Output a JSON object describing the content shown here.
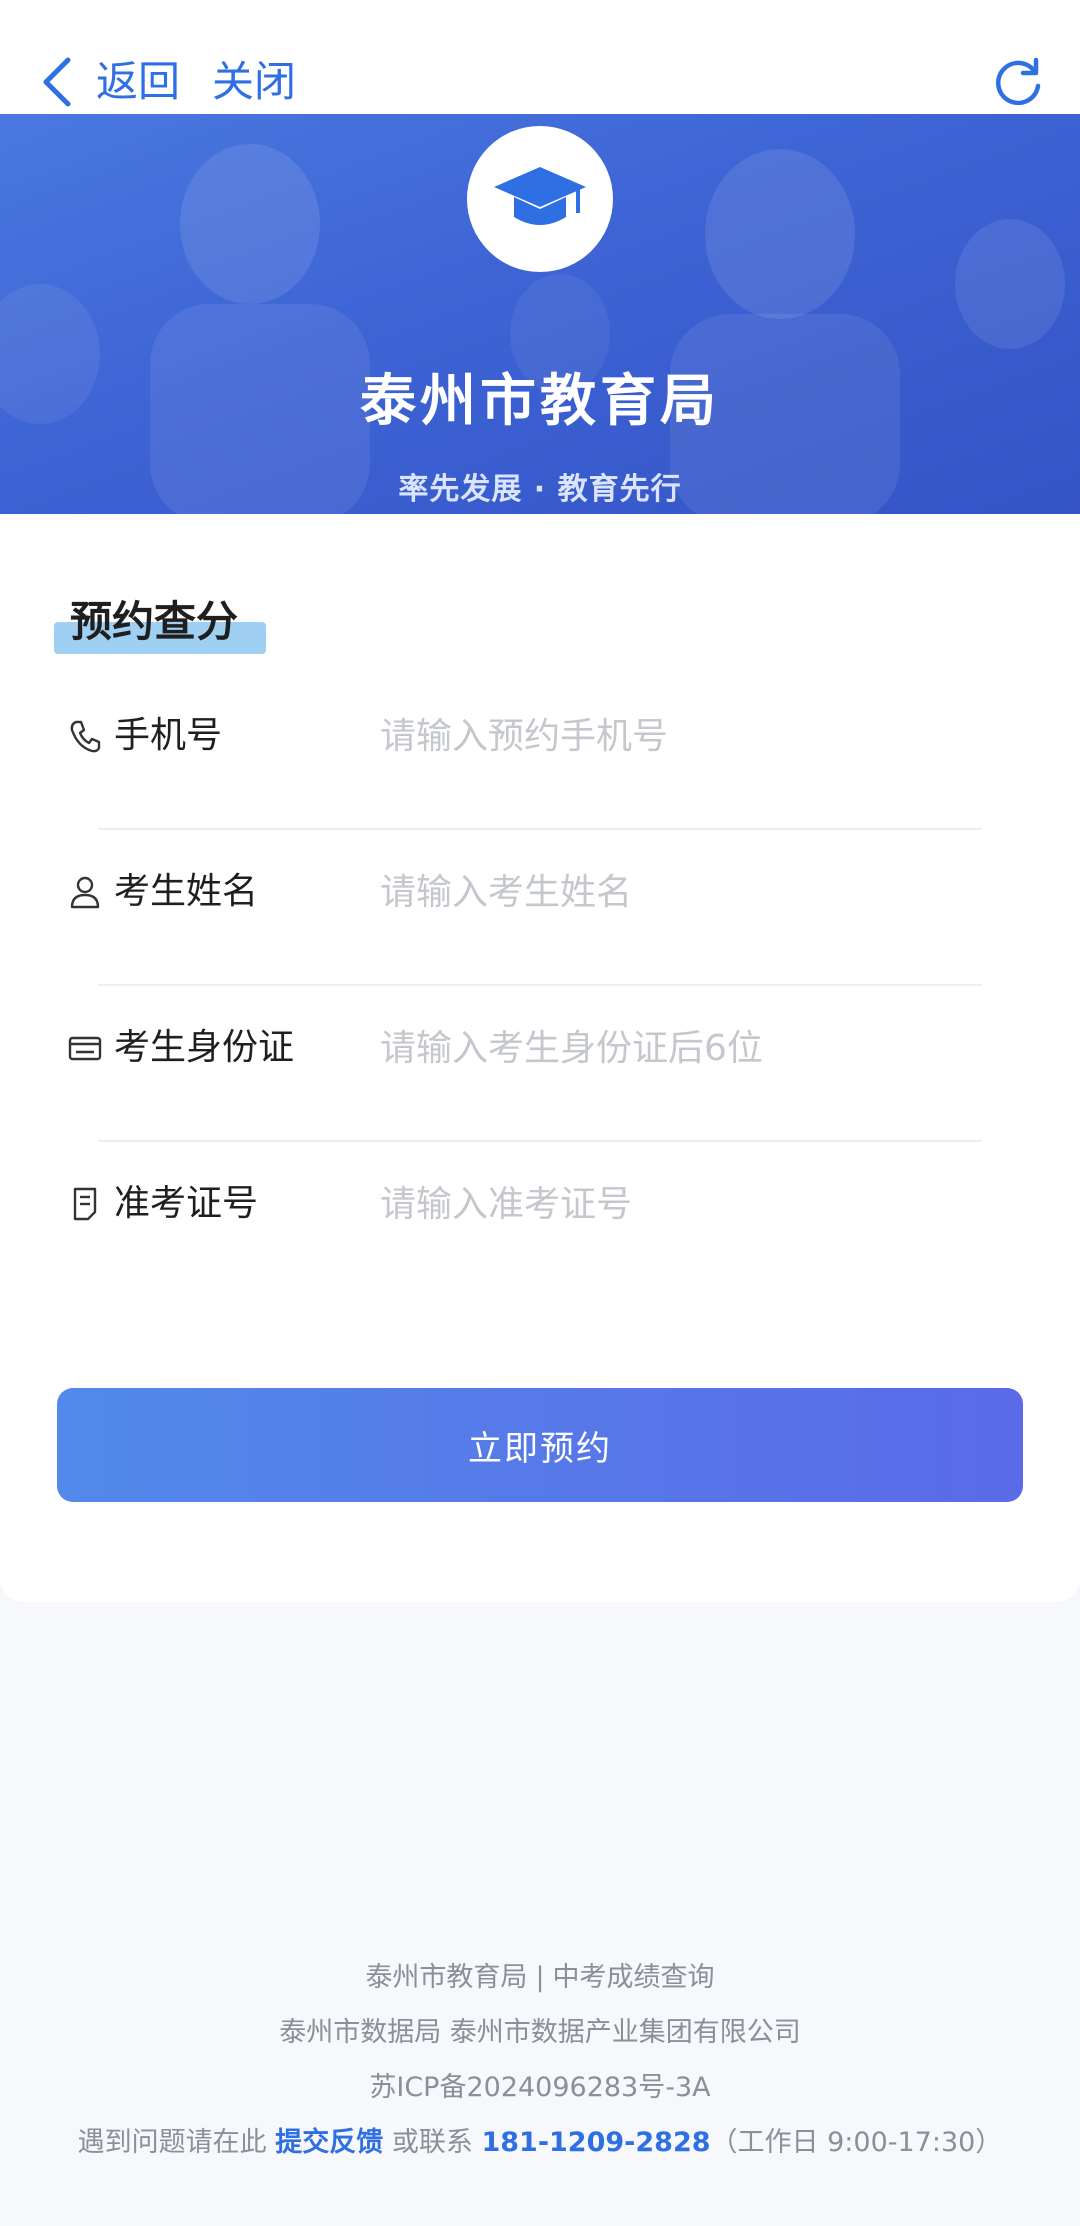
{
  "nav": {
    "back_label": "返回",
    "close_label": "关闭",
    "accent_color": "#2f6fe4"
  },
  "banner": {
    "title": "泰州市教育局",
    "subtitle": "率先发展 · 教育先行",
    "logo_icon": "graduation-cap-icon"
  },
  "form": {
    "section_title": "预约查分",
    "fields": [
      {
        "icon": "phone-icon",
        "label": "手机号",
        "placeholder": "请输入预约手机号",
        "value": ""
      },
      {
        "icon": "user-icon",
        "label": "考生姓名",
        "placeholder": "请输入考生姓名",
        "value": ""
      },
      {
        "icon": "id-card-icon",
        "label": "考生身份证",
        "placeholder": "请输入考生身份证后6位",
        "value": ""
      },
      {
        "icon": "admission-ticket-icon",
        "label": "准考证号",
        "placeholder": "请输入准考证号",
        "value": ""
      }
    ],
    "submit_label": "立即预约"
  },
  "footer": {
    "org": "泰州市教育局",
    "separator": "|",
    "service": "中考成绩查询",
    "operators": "泰州市数据局 泰州市数据产业集团有限公司",
    "icp": "苏ICP备2024096283号-3A",
    "help_prefix": "遇到问题请在此",
    "feedback_link": "提交反馈",
    "contact_prefix": "或联系",
    "phone": "181-1209-2828",
    "hours": "（工作日 9:00-17:30）"
  }
}
